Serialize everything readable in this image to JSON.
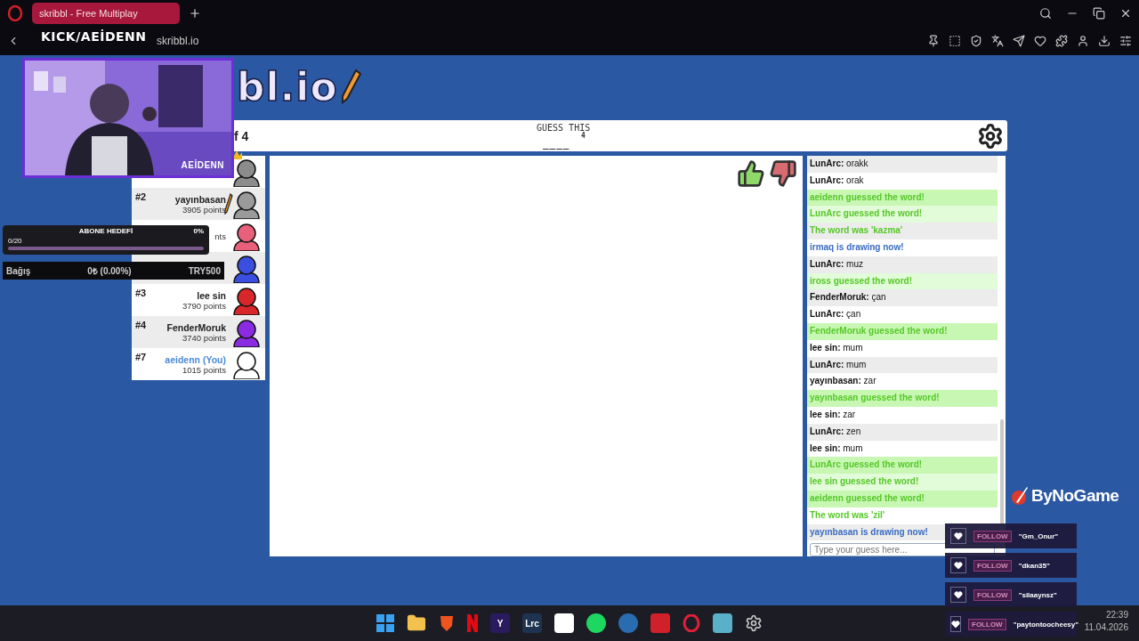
{
  "browser": {
    "tab_title": "skribbl - Free Multiplay",
    "address": "skribbl.io"
  },
  "stream_overlay": {
    "channel": "KICK/AEİDENN",
    "webcam_name": "AEİDENN",
    "goal": {
      "title": "ABONE HEDEFİ",
      "count": "0/20",
      "percent": "0%",
      "level": 0
    },
    "donation": {
      "label": "Bağış",
      "amount": "0₺ (0.00%)",
      "target": "TRY500"
    },
    "sponsor": "ByNoGame",
    "follows": [
      {
        "badge": "FOLLOW",
        "name": "\"Gm_Onur\""
      },
      {
        "badge": "FOLLOW",
        "name": "\"dkan35\""
      },
      {
        "badge": "FOLLOW",
        "name": "\"silaaynsz\""
      },
      {
        "badge": "FOLLOW",
        "name": "\"paytontoocheesy\""
      }
    ]
  },
  "game": {
    "logo": "bl.io",
    "round": "f 4",
    "hint_label": "GUESS THIS",
    "word_length": "4",
    "word_pattern": "____",
    "players": [
      {
        "color": "#8c8c8c",
        "crown": true,
        "drawing": false
      },
      {
        "rank": "#2",
        "name": "yayınbasan",
        "points": "3905 points",
        "color": "#9a9a9a",
        "crown": false,
        "drawing": true,
        "you": false
      },
      {
        "points": "nts",
        "color": "#e8607a",
        "crown": false,
        "drawing": false
      },
      {
        "color": "#3a4fe0",
        "crown": false,
        "drawing": false
      },
      {
        "rank": "#3",
        "name": "lee sin",
        "points": "3790 points",
        "color": "#d8262a",
        "crown": false,
        "drawing": false,
        "you": false
      },
      {
        "rank": "#4",
        "name": "FenderMoruk",
        "points": "3740 points",
        "color": "#8a2be2",
        "crown": false,
        "drawing": false,
        "you": false
      },
      {
        "rank": "#7",
        "name": "aeidenn (You)",
        "points": "1015 points",
        "color": "#ffffff",
        "crown": false,
        "drawing": false,
        "you": true
      }
    ],
    "chat": {
      "messages": [
        {
          "kind": "message",
          "author": "LunArc:",
          "text": "orakk"
        },
        {
          "kind": "message",
          "author": "LunArc:",
          "text": "orak"
        },
        {
          "kind": "guessed",
          "text": "aeidenn guessed the word!"
        },
        {
          "kind": "guessed",
          "text": "LunArc guessed the word!"
        },
        {
          "kind": "word",
          "text": "The word was 'kazma'"
        },
        {
          "kind": "drawing",
          "text": "irmaq is drawing now!"
        },
        {
          "kind": "message",
          "author": "LunArc:",
          "text": "muz"
        },
        {
          "kind": "guessed",
          "text": "iross guessed the word!"
        },
        {
          "kind": "message",
          "author": "FenderMoruk:",
          "text": "çan"
        },
        {
          "kind": "message",
          "author": "LunArc:",
          "text": "çan"
        },
        {
          "kind": "guessed",
          "text": "FenderMoruk guessed the word!"
        },
        {
          "kind": "message",
          "author": "lee sin:",
          "text": "mum"
        },
        {
          "kind": "message",
          "author": "LunArc:",
          "text": "mum"
        },
        {
          "kind": "message",
          "author": "yayınbasan:",
          "text": "zar"
        },
        {
          "kind": "guessed",
          "text": "yayınbasan guessed the word!"
        },
        {
          "kind": "message",
          "author": "lee sin:",
          "text": "zar"
        },
        {
          "kind": "message",
          "author": "LunArc:",
          "text": "zen"
        },
        {
          "kind": "message",
          "author": "lee sin:",
          "text": "mum"
        },
        {
          "kind": "guessed",
          "text": "LunArc guessed the word!"
        },
        {
          "kind": "guessed",
          "text": "lee sin guessed the word!"
        },
        {
          "kind": "guessed",
          "text": "aeidenn guessed the word!"
        },
        {
          "kind": "word",
          "text": "The word was 'zil'"
        },
        {
          "kind": "drawing",
          "text": "yayınbasan is drawing now!"
        }
      ],
      "placeholder": "Type your guess here..."
    }
  },
  "taskbar": {
    "apps": [
      {
        "kind": "windows",
        "color": "#3aa0f0"
      },
      {
        "kind": "folder",
        "color": "#f2c14e"
      },
      {
        "kind": "shield",
        "color": "#f0541e"
      },
      {
        "kind": "stripe",
        "color": "#e50914"
      },
      {
        "kind": "label",
        "label": "Y",
        "color": "#2a1a5e"
      },
      {
        "kind": "label",
        "label": "Lrc",
        "color": "#1e3350"
      },
      {
        "kind": "square",
        "color": "#ffffff"
      },
      {
        "kind": "circle",
        "color": "#1ed760"
      },
      {
        "kind": "circle",
        "color": "#2a6cb0"
      },
      {
        "kind": "square",
        "color": "#d0202a"
      },
      {
        "kind": "ring",
        "color": "#e0203a"
      },
      {
        "kind": "square",
        "color": "#5ab0c8"
      },
      {
        "kind": "gear",
        "color": "#c8c8c8"
      }
    ],
    "time": "22:39",
    "date": "11.04.2026"
  }
}
